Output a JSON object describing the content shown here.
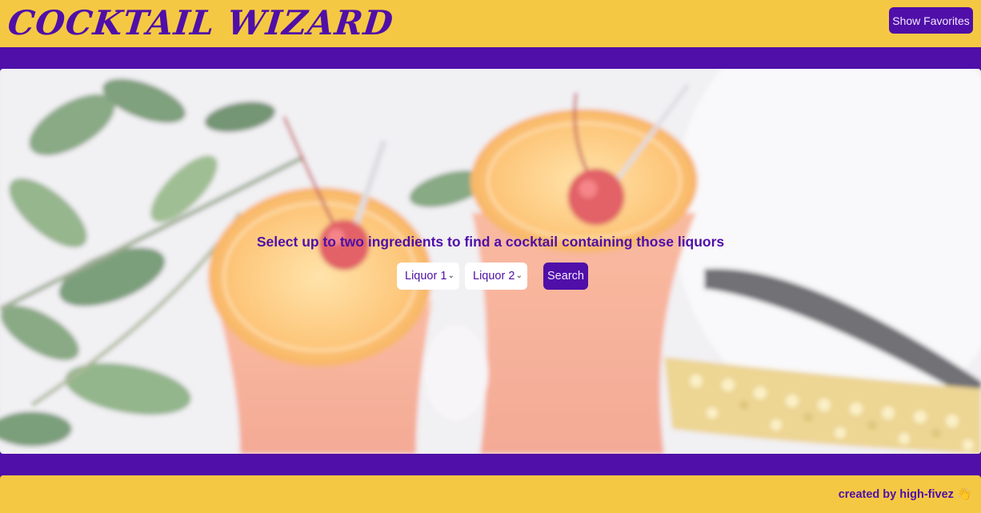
{
  "header": {
    "logo": "COCKTAIL WIZARD",
    "favorites_button": "Show Favorites"
  },
  "hero": {
    "image_icon": "cocktail-photo",
    "prompt": "Select up to two ingredients to find a cocktail containing those liquors",
    "liquor_select_1": "Liquor 1",
    "liquor_select_2": "Liquor 2",
    "search_button": "Search"
  },
  "footer": {
    "credit": "created by high-fivez 👋"
  },
  "colors": {
    "yellow": "#f5c843",
    "purple": "#4f0fa8"
  }
}
